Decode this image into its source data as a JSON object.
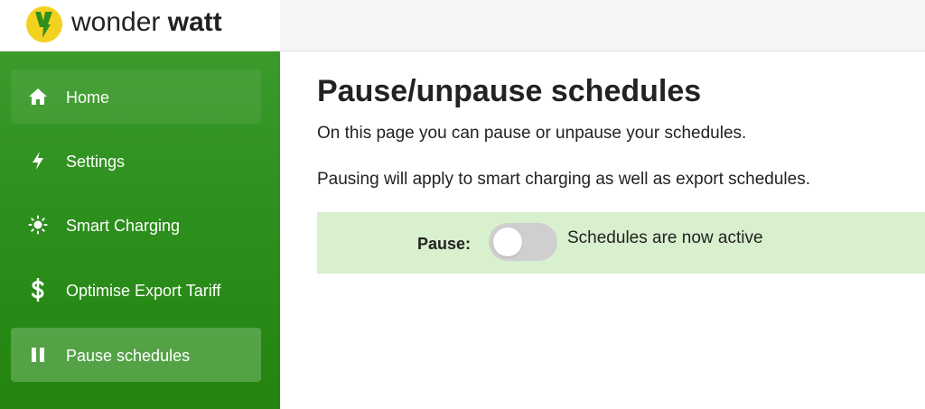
{
  "brand": {
    "name_light": "wonder ",
    "name_bold": "watt",
    "logo_icon": "lightning-logo-icon",
    "colors": {
      "logo_fill": "#f3d21f",
      "logo_bolt": "#2e8f1b",
      "sidebar_green": "#2d8f1d",
      "panel_green": "#d8f0cd"
    }
  },
  "sidebar": {
    "items": [
      {
        "label": "Home",
        "icon": "home-icon",
        "active": false
      },
      {
        "label": "Settings",
        "icon": "lightning-icon",
        "active": false
      },
      {
        "label": "Smart Charging",
        "icon": "sun-icon",
        "active": false
      },
      {
        "label": "Optimise Export Tariff",
        "icon": "dollar-icon",
        "active": false
      },
      {
        "label": "Pause schedules",
        "icon": "pause-icon",
        "active": true
      }
    ]
  },
  "main": {
    "title": "Pause/unpause schedules",
    "intro": "On this page you can pause or unpause your schedules.",
    "note": "Pausing will apply to smart charging as well as export schedules.",
    "pause": {
      "label": "Pause:",
      "toggle_on": false,
      "status": "Schedules are now active"
    }
  }
}
